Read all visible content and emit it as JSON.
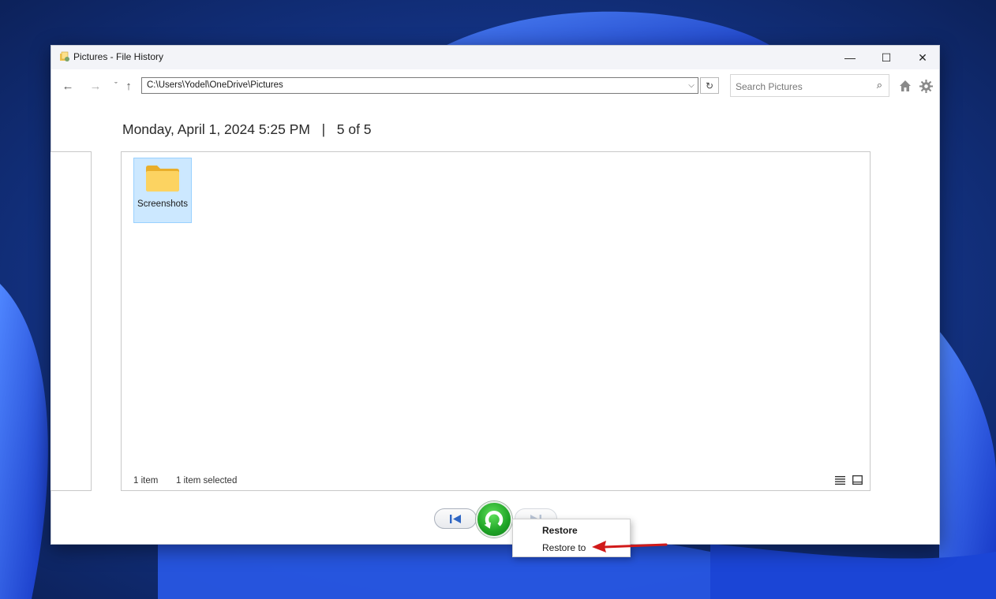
{
  "window": {
    "title": "Pictures - File History",
    "controls": {
      "minimize": "—",
      "maximize": "☐",
      "close": "✕"
    }
  },
  "navbar": {
    "back": "←",
    "forward": "→",
    "recent": "ˇ",
    "up": "↑",
    "address": "C:\\Users\\Yodel\\OneDrive\\Pictures",
    "address_drop": "⌵",
    "refresh": "↻",
    "search_placeholder": "Search Pictures",
    "search_icon": "⌕"
  },
  "header": {
    "date": "Monday, April 1, 2024 5:25 PM",
    "separator": "|",
    "position": "5 of 5"
  },
  "files": [
    {
      "name": "Screenshots",
      "icon": "folder-icon",
      "selected": true
    }
  ],
  "status": {
    "count": "1 item",
    "selection": "1 item selected"
  },
  "context_menu": {
    "items": [
      {
        "label": "Restore",
        "bold": true
      },
      {
        "label": "Restore to",
        "bold": false
      }
    ]
  },
  "colors": {
    "restore_green": "#1ea326",
    "selection_fill": "#cce8ff",
    "selection_border": "#99d1ff",
    "annotation_arrow": "#d11a1a",
    "folder_yellow": "#f5c84a"
  }
}
